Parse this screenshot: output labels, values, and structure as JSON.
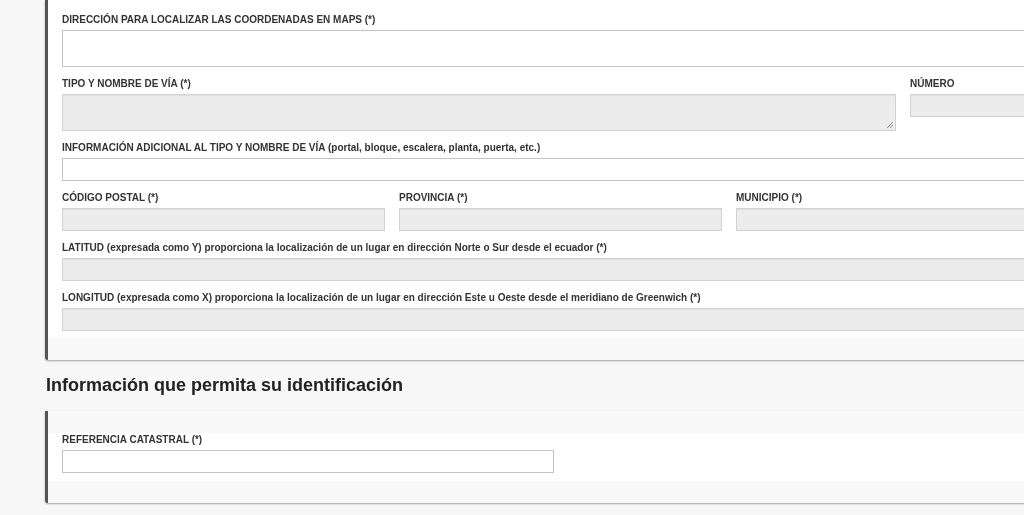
{
  "sections": [
    {
      "fields": [
        {
          "label": "DIRECCIÓN PARA LOCALIZAR LAS COORDENADAS EN MAPS (*)",
          "kind": "tall",
          "disabled": false
        },
        {
          "label": "TIPO Y NOMBRE DE VÍA (*)",
          "kind": "textarea",
          "disabled": true
        },
        {
          "label": "NÚMERO",
          "kind": "narrow",
          "disabled": true
        },
        {
          "label": "INFORMACIÓN ADICIONAL AL TIPO Y NOMBRE DE VÍA (portal, bloque, escalera, planta, puerta, etc.)",
          "kind": "full",
          "disabled": false
        },
        {
          "label": "CÓDIGO POSTAL (*)",
          "kind": "third",
          "disabled": true
        },
        {
          "label": "PROVINCIA (*)",
          "kind": "third",
          "disabled": true
        },
        {
          "label": "MUNICIPIO (*)",
          "kind": "third",
          "disabled": true
        },
        {
          "label": "LATITUD (expresada como Y) proporciona la localización de un lugar en dirección Norte o Sur desde el ecuador (*)",
          "kind": "full",
          "disabled": true
        },
        {
          "label": "LONGITUD (expresada como X) proporciona la localización de un lugar en dirección Este u Oeste desde el meridiano de Greenwich (*)",
          "kind": "full",
          "disabled": true
        }
      ]
    },
    {
      "heading": "Información que permita su identificación",
      "fields": [
        {
          "label": "REFERENCIA CATASTRAL (*)",
          "kind": "half",
          "disabled": false
        }
      ]
    }
  ]
}
